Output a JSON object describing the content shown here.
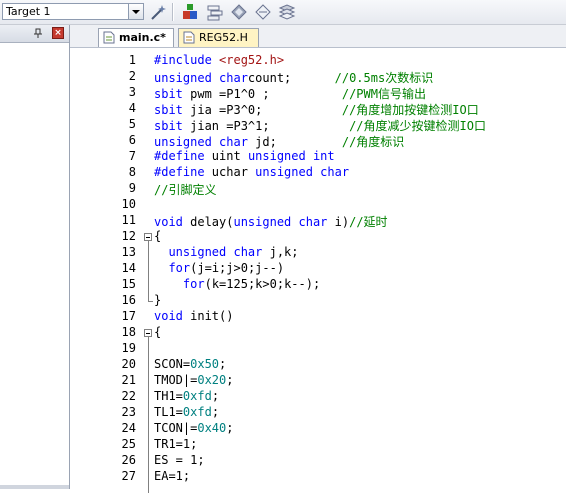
{
  "toolbar": {
    "target": "Target 1",
    "icons": [
      "magic-wand-icon",
      "download-icon",
      "layers-icon",
      "diamond-icon",
      "diamond-outline-icon",
      "books-icon"
    ]
  },
  "tabs": [
    {
      "label": "main.c*",
      "active": true
    },
    {
      "label": "REG52.H",
      "active": false
    }
  ],
  "colors": {
    "keyword": "#0000ff",
    "comment": "#008000",
    "hex": "#008080"
  },
  "lines": [
    {
      "n": "1",
      "parts": [
        [
          "kw",
          "#include "
        ],
        [
          "str",
          "<reg52.h>"
        ]
      ]
    },
    {
      "n": "2",
      "parts": [
        [
          "kw",
          "unsigned char"
        ],
        [
          "",
          "count;      "
        ],
        [
          "cm",
          "//0.5ms次数标识"
        ]
      ]
    },
    {
      "n": "3",
      "parts": [
        [
          "kw",
          "sbit"
        ],
        [
          "",
          " pwm =P1^0 ;          "
        ],
        [
          "cm",
          "//PWM信号输出"
        ]
      ]
    },
    {
      "n": "4",
      "parts": [
        [
          "kw",
          "sbit"
        ],
        [
          "",
          " jia =P3^0;           "
        ],
        [
          "cm",
          "//角度增加按键检测IO口"
        ]
      ]
    },
    {
      "n": "5",
      "parts": [
        [
          "kw",
          "sbit"
        ],
        [
          "",
          " jian =P3^1;           "
        ],
        [
          "cm",
          "//角度减少按键检测IO口"
        ]
      ]
    },
    {
      "n": "6",
      "parts": [
        [
          "kw",
          "unsigned char"
        ],
        [
          "",
          " jd;         "
        ],
        [
          "cm",
          "//角度标识"
        ]
      ]
    },
    {
      "n": "7",
      "parts": [
        [
          "kw",
          "#define"
        ],
        [
          "",
          " uint "
        ],
        [
          "kw",
          "unsigned int"
        ]
      ]
    },
    {
      "n": "8",
      "parts": [
        [
          "kw",
          "#define"
        ],
        [
          "",
          " uchar "
        ],
        [
          "kw",
          "unsigned char"
        ]
      ]
    },
    {
      "n": "9",
      "parts": [
        [
          "cm",
          "//引脚定义"
        ]
      ]
    },
    {
      "n": "10",
      "parts": []
    },
    {
      "n": "11",
      "parts": [
        [
          "kw",
          "void"
        ],
        [
          "",
          " delay("
        ],
        [
          "kw",
          "unsigned char"
        ],
        [
          "",
          " i)"
        ],
        [
          "cm",
          "//延时"
        ]
      ]
    },
    {
      "n": "12",
      "parts": [
        [
          "",
          "{"
        ]
      ]
    },
    {
      "n": "13",
      "parts": [
        [
          "",
          "  "
        ],
        [
          "kw",
          "unsigned char"
        ],
        [
          "",
          " j,k;"
        ]
      ]
    },
    {
      "n": "14",
      "parts": [
        [
          "",
          "  "
        ],
        [
          "kw",
          "for"
        ],
        [
          "",
          "(j=i;j>0;j--)"
        ]
      ]
    },
    {
      "n": "15",
      "parts": [
        [
          "",
          "    "
        ],
        [
          "kw",
          "for"
        ],
        [
          "",
          "(k=125;k>0;k--);"
        ]
      ]
    },
    {
      "n": "16",
      "parts": [
        [
          "",
          "}"
        ]
      ]
    },
    {
      "n": "17",
      "parts": [
        [
          "kw",
          "void"
        ],
        [
          "",
          " init()"
        ]
      ]
    },
    {
      "n": "18",
      "parts": [
        [
          "",
          "{"
        ]
      ]
    },
    {
      "n": "19",
      "parts": []
    },
    {
      "n": "20",
      "parts": [
        [
          "",
          "SCON="
        ],
        [
          "hex",
          "0x50"
        ],
        [
          "",
          ";"
        ]
      ]
    },
    {
      "n": "21",
      "parts": [
        [
          "",
          "TMOD|="
        ],
        [
          "hex",
          "0x20"
        ],
        [
          "",
          ";"
        ]
      ]
    },
    {
      "n": "22",
      "parts": [
        [
          "",
          "TH1="
        ],
        [
          "hex",
          "0xfd"
        ],
        [
          "",
          ";"
        ]
      ]
    },
    {
      "n": "23",
      "parts": [
        [
          "",
          "TL1="
        ],
        [
          "hex",
          "0xfd"
        ],
        [
          "",
          ";"
        ]
      ]
    },
    {
      "n": "24",
      "parts": [
        [
          "",
          "TCON|="
        ],
        [
          "hex",
          "0x40"
        ],
        [
          "",
          ";"
        ]
      ]
    },
    {
      "n": "25",
      "parts": [
        [
          "",
          "TR1=1;"
        ]
      ]
    },
    {
      "n": "26",
      "parts": [
        [
          "",
          "ES = 1;"
        ]
      ]
    },
    {
      "n": "27",
      "parts": [
        [
          "",
          "EA=1;"
        ]
      ]
    }
  ]
}
